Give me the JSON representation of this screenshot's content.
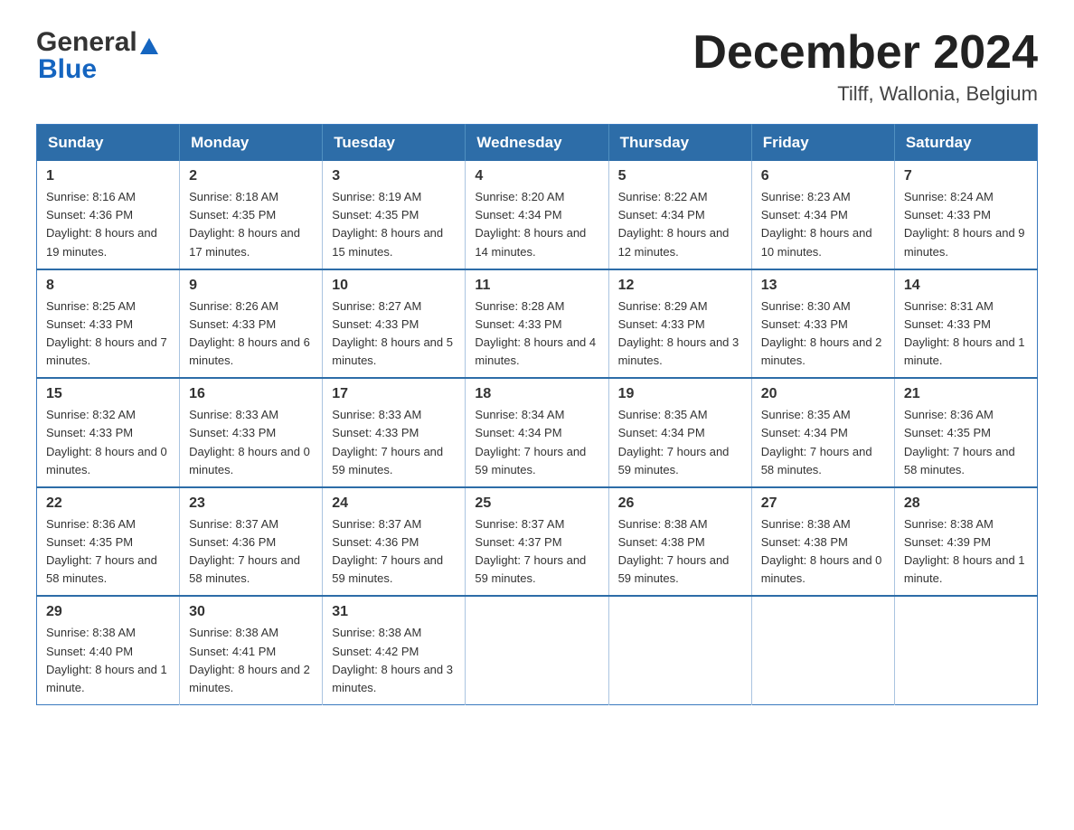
{
  "logo": {
    "general": "General",
    "blue": "Blue"
  },
  "title": {
    "month": "December 2024",
    "location": "Tilff, Wallonia, Belgium"
  },
  "headers": [
    "Sunday",
    "Monday",
    "Tuesday",
    "Wednesday",
    "Thursday",
    "Friday",
    "Saturday"
  ],
  "weeks": [
    [
      {
        "day": "1",
        "sunrise": "8:16 AM",
        "sunset": "4:36 PM",
        "daylight": "8 hours and 19 minutes."
      },
      {
        "day": "2",
        "sunrise": "8:18 AM",
        "sunset": "4:35 PM",
        "daylight": "8 hours and 17 minutes."
      },
      {
        "day": "3",
        "sunrise": "8:19 AM",
        "sunset": "4:35 PM",
        "daylight": "8 hours and 15 minutes."
      },
      {
        "day": "4",
        "sunrise": "8:20 AM",
        "sunset": "4:34 PM",
        "daylight": "8 hours and 14 minutes."
      },
      {
        "day": "5",
        "sunrise": "8:22 AM",
        "sunset": "4:34 PM",
        "daylight": "8 hours and 12 minutes."
      },
      {
        "day": "6",
        "sunrise": "8:23 AM",
        "sunset": "4:34 PM",
        "daylight": "8 hours and 10 minutes."
      },
      {
        "day": "7",
        "sunrise": "8:24 AM",
        "sunset": "4:33 PM",
        "daylight": "8 hours and 9 minutes."
      }
    ],
    [
      {
        "day": "8",
        "sunrise": "8:25 AM",
        "sunset": "4:33 PM",
        "daylight": "8 hours and 7 minutes."
      },
      {
        "day": "9",
        "sunrise": "8:26 AM",
        "sunset": "4:33 PM",
        "daylight": "8 hours and 6 minutes."
      },
      {
        "day": "10",
        "sunrise": "8:27 AM",
        "sunset": "4:33 PM",
        "daylight": "8 hours and 5 minutes."
      },
      {
        "day": "11",
        "sunrise": "8:28 AM",
        "sunset": "4:33 PM",
        "daylight": "8 hours and 4 minutes."
      },
      {
        "day": "12",
        "sunrise": "8:29 AM",
        "sunset": "4:33 PM",
        "daylight": "8 hours and 3 minutes."
      },
      {
        "day": "13",
        "sunrise": "8:30 AM",
        "sunset": "4:33 PM",
        "daylight": "8 hours and 2 minutes."
      },
      {
        "day": "14",
        "sunrise": "8:31 AM",
        "sunset": "4:33 PM",
        "daylight": "8 hours and 1 minute."
      }
    ],
    [
      {
        "day": "15",
        "sunrise": "8:32 AM",
        "sunset": "4:33 PM",
        "daylight": "8 hours and 0 minutes."
      },
      {
        "day": "16",
        "sunrise": "8:33 AM",
        "sunset": "4:33 PM",
        "daylight": "8 hours and 0 minutes."
      },
      {
        "day": "17",
        "sunrise": "8:33 AM",
        "sunset": "4:33 PM",
        "daylight": "7 hours and 59 minutes."
      },
      {
        "day": "18",
        "sunrise": "8:34 AM",
        "sunset": "4:34 PM",
        "daylight": "7 hours and 59 minutes."
      },
      {
        "day": "19",
        "sunrise": "8:35 AM",
        "sunset": "4:34 PM",
        "daylight": "7 hours and 59 minutes."
      },
      {
        "day": "20",
        "sunrise": "8:35 AM",
        "sunset": "4:34 PM",
        "daylight": "7 hours and 58 minutes."
      },
      {
        "day": "21",
        "sunrise": "8:36 AM",
        "sunset": "4:35 PM",
        "daylight": "7 hours and 58 minutes."
      }
    ],
    [
      {
        "day": "22",
        "sunrise": "8:36 AM",
        "sunset": "4:35 PM",
        "daylight": "7 hours and 58 minutes."
      },
      {
        "day": "23",
        "sunrise": "8:37 AM",
        "sunset": "4:36 PM",
        "daylight": "7 hours and 58 minutes."
      },
      {
        "day": "24",
        "sunrise": "8:37 AM",
        "sunset": "4:36 PM",
        "daylight": "7 hours and 59 minutes."
      },
      {
        "day": "25",
        "sunrise": "8:37 AM",
        "sunset": "4:37 PM",
        "daylight": "7 hours and 59 minutes."
      },
      {
        "day": "26",
        "sunrise": "8:38 AM",
        "sunset": "4:38 PM",
        "daylight": "7 hours and 59 minutes."
      },
      {
        "day": "27",
        "sunrise": "8:38 AM",
        "sunset": "4:38 PM",
        "daylight": "8 hours and 0 minutes."
      },
      {
        "day": "28",
        "sunrise": "8:38 AM",
        "sunset": "4:39 PM",
        "daylight": "8 hours and 1 minute."
      }
    ],
    [
      {
        "day": "29",
        "sunrise": "8:38 AM",
        "sunset": "4:40 PM",
        "daylight": "8 hours and 1 minute."
      },
      {
        "day": "30",
        "sunrise": "8:38 AM",
        "sunset": "4:41 PM",
        "daylight": "8 hours and 2 minutes."
      },
      {
        "day": "31",
        "sunrise": "8:38 AM",
        "sunset": "4:42 PM",
        "daylight": "8 hours and 3 minutes."
      },
      null,
      null,
      null,
      null
    ]
  ]
}
